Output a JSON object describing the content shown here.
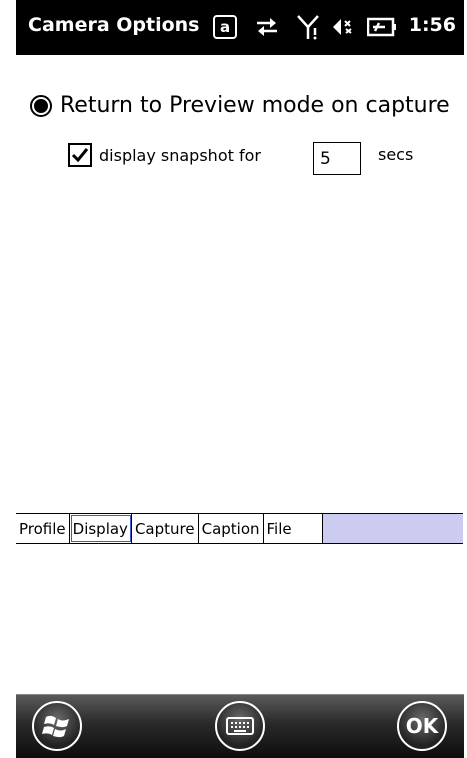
{
  "status_bar": {
    "title": "Camera Options",
    "time": "1:56",
    "icons": [
      "at-sign-icon",
      "sync-arrows-icon",
      "signal-icon",
      "speaker-muted-icon",
      "battery-icon"
    ]
  },
  "content": {
    "radio_label": "Return to Preview mode on capture",
    "radio_selected": true,
    "checkbox_label": "display snapshot for",
    "checkbox_checked": true,
    "secs_value": "5",
    "secs_unit": "secs"
  },
  "tabs": [
    {
      "label": "Profile",
      "active": false
    },
    {
      "label": "Display",
      "active": true
    },
    {
      "label": "Capture",
      "active": false
    },
    {
      "label": "Caption",
      "active": false
    },
    {
      "label": "File",
      "active": false
    }
  ],
  "softkeys": {
    "start_icon": "windows-logo-icon",
    "keyboard_icon": "keyboard-icon",
    "ok_label": "OK"
  },
  "colors": {
    "status_bg": "#000000",
    "tab_bg": "#ccccf0",
    "active_tab_outline": "#3a5ad8",
    "softbar_bg": "#1a1a1a"
  }
}
